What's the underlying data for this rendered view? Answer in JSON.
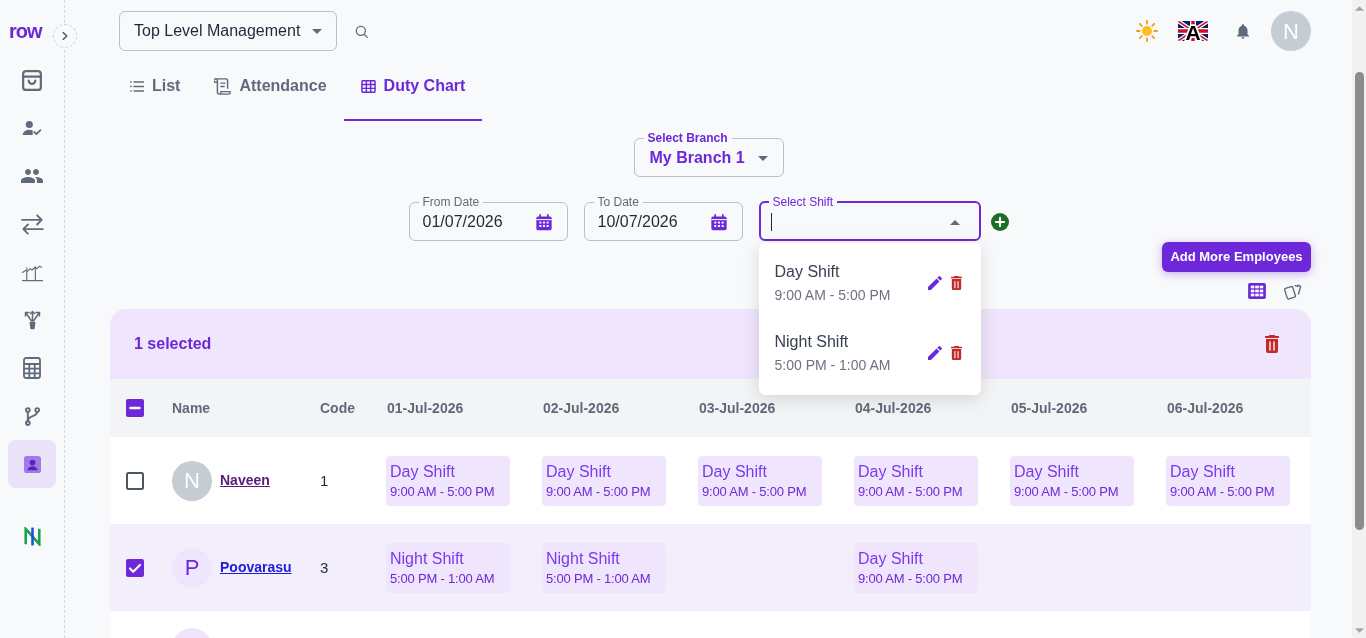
{
  "sidebar": {
    "logo": "row",
    "items": [
      {
        "selected": false
      },
      {
        "selected": false
      },
      {
        "selected": false
      },
      {
        "selected": false
      },
      {
        "selected": false
      },
      {
        "selected": false
      },
      {
        "selected": false
      },
      {
        "selected": false
      },
      {
        "selected": true
      }
    ]
  },
  "header": {
    "organization_select": {
      "value": "Top Level Management"
    },
    "language": {
      "letter": "A"
    },
    "user_avatar": {
      "initial": "N"
    }
  },
  "tabs": [
    {
      "label": "List",
      "selected": false
    },
    {
      "label": "Attendance",
      "selected": false
    },
    {
      "label": "Duty Chart",
      "selected": true
    }
  ],
  "filters": {
    "branch": {
      "label": "Select Branch",
      "value": "My Branch 1"
    },
    "from_date": {
      "label": "From Date",
      "value": "01/07/2026"
    },
    "to_date": {
      "label": "To Date",
      "value": "10/07/2026"
    },
    "shift": {
      "label": "Select Shift",
      "expanded": true,
      "options": [
        {
          "name": "Day Shift",
          "time": "9:00 AM - 5:00 PM"
        },
        {
          "name": "Night Shift",
          "time": "5:00 PM - 1:00 AM"
        }
      ]
    }
  },
  "add_employees_button": "Add More Employees",
  "view_toggle": [
    {
      "selected": true
    },
    {
      "selected": false
    }
  ],
  "table": {
    "selection_bar": "1 selected",
    "header_checkbox": {
      "indeterminate": true
    },
    "columns": [
      "Name",
      "Code",
      "01-Jul-2026",
      "02-Jul-2026",
      "03-Jul-2026",
      "04-Jul-2026",
      "05-Jul-2026",
      "06-Jul-2026"
    ],
    "rows": [
      {
        "selected": false,
        "avatar": {
          "initial": "N",
          "color": "#c5ccd4"
        },
        "name": {
          "text": "Naveen",
          "visited": true
        },
        "code": "1",
        "shifts": [
          {
            "kind": "shift",
            "name": "Day Shift",
            "time": "9:00 AM - 5:00 PM"
          },
          {
            "kind": "shift",
            "name": "Day Shift",
            "time": "9:00 AM - 5:00 PM"
          },
          {
            "kind": "shift",
            "name": "Day Shift",
            "time": "9:00 AM - 5:00 PM"
          },
          {
            "kind": "shift",
            "name": "Day Shift",
            "time": "9:00 AM - 5:00 PM"
          },
          {
            "kind": "shift",
            "name": "Day Shift",
            "time": "9:00 AM - 5:00 PM"
          },
          {
            "kind": "shift",
            "name": "Day Shift",
            "time": "9:00 AM - 5:00 PM"
          }
        ]
      },
      {
        "selected": true,
        "avatar": {
          "initial": "P",
          "color": "#efe5fd"
        },
        "name": {
          "text": "Poovarasu",
          "visited": false
        },
        "code": "3",
        "shifts": [
          {
            "kind": "shift",
            "name": "Night Shift",
            "time": "5:00 PM - 1:00 AM"
          },
          {
            "kind": "shift",
            "name": "Night Shift",
            "time": "5:00 PM - 1:00 AM"
          },
          {
            "kind": "empty"
          },
          {
            "kind": "shift",
            "name": "Day Shift",
            "time": "9:00 AM - 5:00 PM"
          },
          {
            "kind": "empty"
          },
          {
            "kind": "empty"
          }
        ]
      },
      {
        "avatar": {
          "color": "#efe5fd"
        }
      }
    ]
  }
}
